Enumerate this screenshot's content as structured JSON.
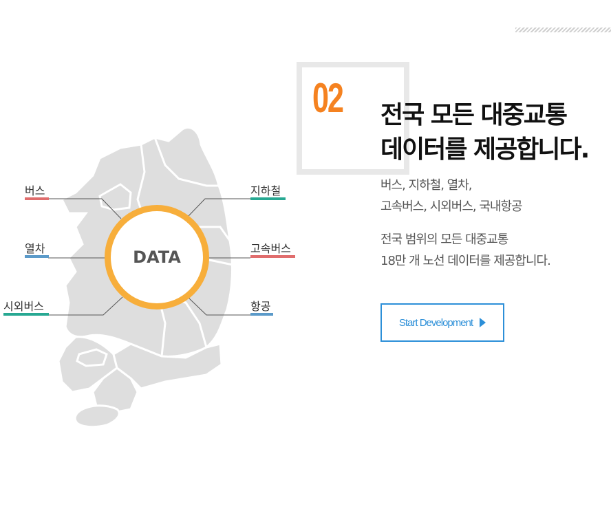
{
  "data_hub": {
    "center_label": "DATA",
    "categories": [
      {
        "label": "버스",
        "color": "#e06d6d"
      },
      {
        "label": "열차",
        "color": "#5b9ac9"
      },
      {
        "label": "시외버스",
        "color": "#27a892"
      },
      {
        "label": "지하철",
        "color": "#27a892"
      },
      {
        "label": "고속버스",
        "color": "#e06d6d"
      },
      {
        "label": "항공",
        "color": "#5b9ac9"
      }
    ]
  },
  "section": {
    "number": "02",
    "title_line1": "전국 모든 대중교통",
    "title_line2": "데이터를 제공합니다.",
    "desc1_line1": "버스, 지하철, 열차,",
    "desc1_line2": "고속버스, 시외버스, 국내항공",
    "desc2_line1": "전국 범위의 모든 대중교통",
    "desc2_line2": "18만 개 노선 데이터를 제공합니다."
  },
  "cta": {
    "label": "Start Development"
  },
  "colors": {
    "accent": "#f58220",
    "ring": "#f7ae3b",
    "button": "#2c8fd8",
    "map": "#dcdcdc"
  }
}
